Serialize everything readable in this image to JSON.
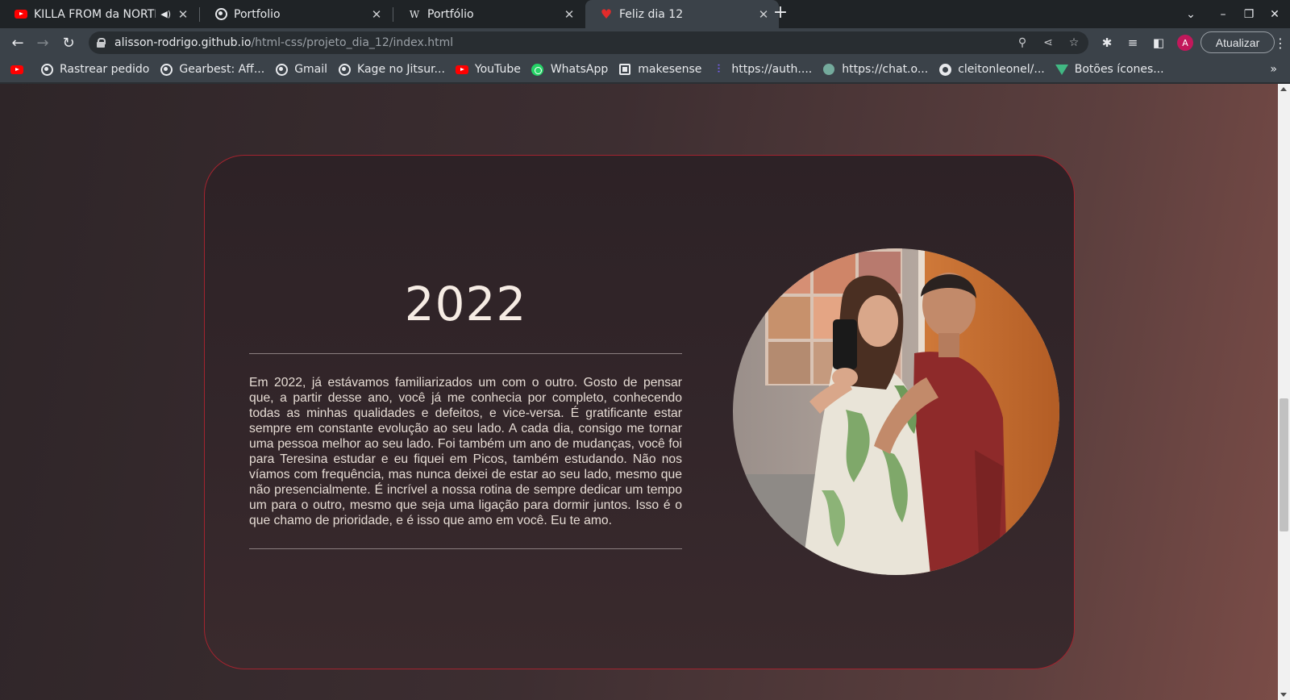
{
  "tabs": [
    {
      "title": "KILLA FROM da NORTH",
      "favicon": "youtube-icon",
      "audio": true
    },
    {
      "title": "Portfolio",
      "favicon": "globe-icon"
    },
    {
      "title": "Portfólio",
      "favicon": "wikipedia-w-icon"
    },
    {
      "title": "Feliz dia 12",
      "favicon": "heart-icon",
      "active": true
    }
  ],
  "address": {
    "host": "alisson-rodrigo.github.io",
    "path": "/html-css/projeto_dia_12/index.html"
  },
  "toolbar": {
    "profile_initial": "A",
    "update_label": "Atualizar"
  },
  "bookmarks": [
    {
      "label": "",
      "icon": "youtube-icon"
    },
    {
      "label": "Rastrear pedido",
      "icon": "globe-icon"
    },
    {
      "label": "Gearbest: Aff...",
      "icon": "globe-icon"
    },
    {
      "label": "Gmail",
      "icon": "globe-icon"
    },
    {
      "label": "Kage no Jitsur...",
      "icon": "globe-icon"
    },
    {
      "label": "YouTube",
      "icon": "youtube-icon"
    },
    {
      "label": "WhatsApp",
      "icon": "whatsapp-icon"
    },
    {
      "label": "makesense",
      "icon": "makesense-icon"
    },
    {
      "label": "https://auth....",
      "icon": "auth-icon"
    },
    {
      "label": "https://chat.o...",
      "icon": "chatgpt-icon"
    },
    {
      "label": "cleitonleonel/...",
      "icon": "github-icon"
    },
    {
      "label": "Botões ícones...",
      "icon": "vue-icon"
    }
  ],
  "page": {
    "year": "2022",
    "story": "Em 2022, já estávamos familiarizados um com o outro. Gosto de pensar que, a partir desse ano, você já me conhecia por completo, conhecendo todas as minhas qualidades e defeitos, e vice-versa. É gratificante estar sempre em constante evolução ao seu lado. A cada dia, consigo me tornar uma pessoa melhor ao seu lado. Foi também um ano de mudanças, você foi para Teresina estudar e eu fiquei em Picos, também estudando. Não nos víamos com frequência, mas nunca deixei de estar ao seu lado, mesmo que não presencialmente. É incrível a nossa rotina de sempre dedicar um tempo um para o outro, mesmo que seja uma ligação para dormir juntos. Isso é o que chamo de prioridade, e é isso que amo em você. Eu te amo.",
    "card_border_color": "#a3242f"
  }
}
